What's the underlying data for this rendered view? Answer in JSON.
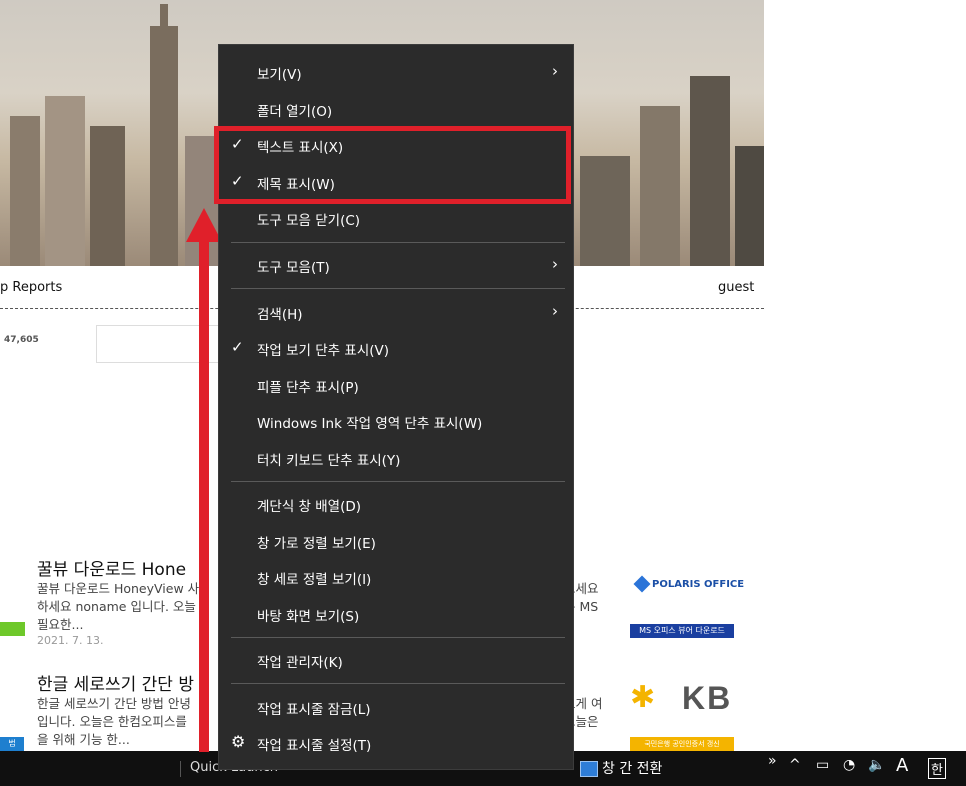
{
  "page": {
    "nav_left": "p Reports",
    "nav_right": "guest",
    "visit_count": "47,605",
    "posts": [
      {
        "title": "꿀뷰 다운로드 Hone",
        "title_cont": "..",
        "line1": "꿀뷰 다운로드 HoneyView 사",
        "line1_right": "으세요",
        "line2": "하세요 noname 입니다. 오늘",
        "line2_right": "은 MS",
        "line3": "필요한...",
        "date": "2021. 7. 13."
      },
      {
        "title": "한글 세로쓰기 간단 방",
        "title_cont": "..",
        "line1": "한글 세로쓰기 간단 방법 안녕",
        "line1_right": "르게 여",
        "line2": "입니다. 오늘은 한컴오피스를",
        "line2_right": "오늘은",
        "line3": "을 위해 기능 한..."
      }
    ],
    "ads": {
      "polaris": "POLARIS OFFICE",
      "ms_banner": "MS 오피스 뷰어 다운로드",
      "kb_text": "KB",
      "kb_banner": "국민은행 공인인증서 갱신"
    },
    "blue_tag": "법"
  },
  "taskbar": {
    "quick_launch": "Quick Launch",
    "switch_label": "창 간 전환",
    "tray_chevron": "»",
    "tray_up": "^",
    "ime_mode": "A",
    "ime_lang": "한"
  },
  "context_menu": {
    "items": [
      {
        "label": "보기(V)",
        "submenu": true,
        "checked": false
      },
      {
        "label": "폴더 열기(O)"
      },
      {
        "label": "텍스트 표시(X)",
        "checked": true
      },
      {
        "label": "제목 표시(W)",
        "checked": true
      },
      {
        "label": "도구 모음 닫기(C)"
      },
      {
        "label": "도구 모음(T)",
        "submenu": true
      },
      {
        "label": "검색(H)",
        "submenu": true
      },
      {
        "label": "작업 보기 단추 표시(V)",
        "checked": true
      },
      {
        "label": "피플 단추 표시(P)"
      },
      {
        "label": "Windows Ink 작업 영역 단추 표시(W)"
      },
      {
        "label": "터치 키보드 단추 표시(Y)"
      },
      {
        "label": "계단식 창 배열(D)"
      },
      {
        "label": "창 가로 정렬 보기(E)"
      },
      {
        "label": "창 세로 정렬 보기(I)"
      },
      {
        "label": "바탕 화면 보기(S)"
      },
      {
        "label": "작업 관리자(K)"
      },
      {
        "label": "작업 표시줄 잠금(L)"
      },
      {
        "label": "작업 표시줄 설정(T)",
        "icon": "gear-icon"
      }
    ],
    "check_glyph": "✓",
    "arrow_glyph": "›",
    "gear_glyph": "⚙"
  },
  "colors": {
    "menu_bg": "#2b2b2b",
    "highlight": "#e0202a",
    "taskbar_bg": "#101010"
  }
}
